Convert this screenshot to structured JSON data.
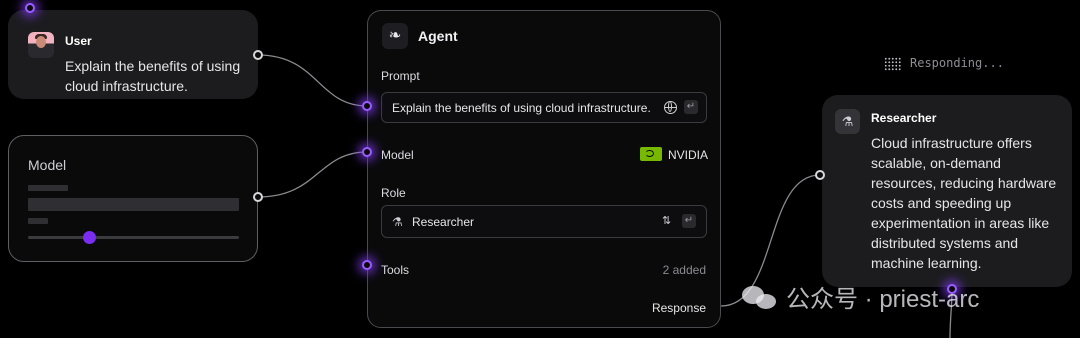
{
  "user_node": {
    "title": "User",
    "message": "Explain the benefits of using cloud infrastructure."
  },
  "model_node": {
    "title": "Model",
    "slider_value": 0.29
  },
  "agent_node": {
    "title": "Agent",
    "prompt_label": "Prompt",
    "prompt_value": "Explain the benefits of using cloud infrastructure.",
    "model_label": "Model",
    "model_value": "NVIDIA",
    "role_label": "Role",
    "role_value": "Researcher",
    "tools_label": "Tools",
    "tools_count": "2 added",
    "response_label": "Response"
  },
  "status": {
    "text": "Responding..."
  },
  "researcher_node": {
    "title": "Researcher",
    "message": "Cloud infrastructure offers scalable, on-demand resources, reducing hardware costs and speeding up experimentation in areas like distributed systems and machine learning."
  },
  "watermark": {
    "text": "公众号 · priest-arc"
  },
  "colors": {
    "background": "#000000",
    "card": "#1c1c1f",
    "accent_purple": "#7c3aed",
    "nvidia_green": "#76b900"
  }
}
